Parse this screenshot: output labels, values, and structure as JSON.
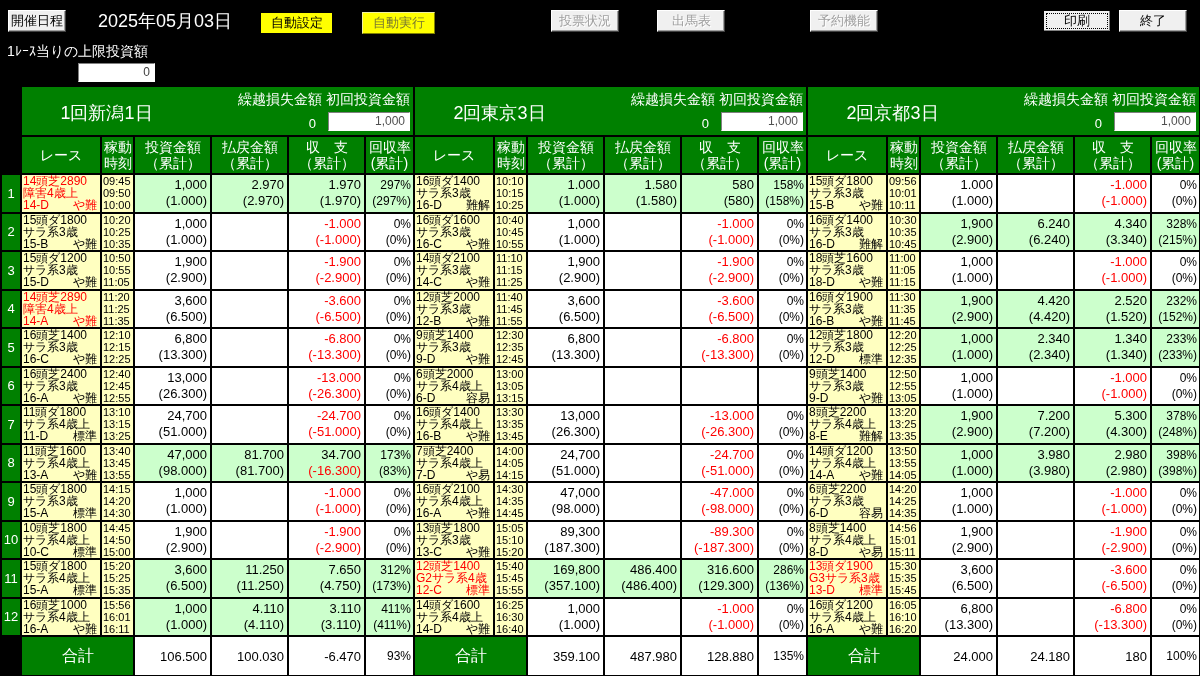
{
  "toolbar": {
    "buttons": [
      {
        "label": "開催日程",
        "kind": "plain",
        "disabled": false,
        "focused": false
      },
      {
        "label": "自動設定",
        "kind": "highlight",
        "on": true,
        "disabled": false,
        "focused": false
      },
      {
        "label": "自動実行",
        "kind": "highlight",
        "on": false,
        "disabled": false,
        "focused": false
      },
      {
        "label": "投票状況",
        "kind": "plain",
        "disabled": true,
        "focused": false
      },
      {
        "label": "出馬表",
        "kind": "plain",
        "disabled": true,
        "focused": false
      },
      {
        "label": "予約機能",
        "kind": "plain",
        "disabled": true,
        "focused": false
      },
      {
        "label": "印刷",
        "kind": "plain",
        "disabled": false,
        "focused": true
      },
      {
        "label": "終了",
        "kind": "plain",
        "disabled": false,
        "focused": false
      }
    ],
    "date": "2025年05月03日"
  },
  "limit": {
    "label": "1ﾚｰｽ当りの上限投資額",
    "value": "0"
  },
  "row_numbers": [
    "1",
    "2",
    "3",
    "4",
    "5",
    "6",
    "7",
    "8",
    "9",
    "10",
    "11",
    "12"
  ],
  "venues": [
    {
      "name": "1回新潟1日",
      "carryover_label": "繰越損失金額",
      "carryover": "0",
      "initial_label": "初回投資金額",
      "initial_amount": "1,000",
      "columns": [
        {
          "lines": [
            "レース"
          ]
        },
        {
          "lines": [
            "稼動",
            "時刻"
          ]
        },
        {
          "lines": [
            "投資金額",
            "（累計）"
          ]
        },
        {
          "lines": [
            "払戻金額",
            "（累計）"
          ]
        },
        {
          "lines": [
            "収　支",
            "（累計）"
          ]
        },
        {
          "lines": [
            "回収率",
            "(累計)"
          ]
        }
      ],
      "races": [
        {
          "featured": true,
          "hit": true,
          "race": [
            "14頭芝2890",
            "障害4歳上"
          ],
          "gate": "14-D",
          "rating": "や難",
          "times": [
            "09:45",
            "09:50",
            "10:00"
          ],
          "investment": [
            "1,000",
            "(1.000)"
          ],
          "payout": [
            "2.970",
            "(2.970)"
          ],
          "balance": [
            {
              "text": "1.970",
              "negative": false
            },
            {
              "text": "(1.970)",
              "negative": false
            }
          ],
          "rate": [
            "297%",
            "(297%)"
          ]
        },
        {
          "featured": false,
          "hit": false,
          "race": [
            "15頭ダ1800",
            "サラ系3歳"
          ],
          "gate": "15-B",
          "rating": "や難",
          "times": [
            "10:20",
            "10:25",
            "10:35"
          ],
          "investment": [
            "1,000",
            "(1.000)"
          ],
          "balance": [
            {
              "text": "-1.000",
              "negative": true
            },
            {
              "text": "(-1.000)",
              "negative": true
            }
          ],
          "rate": [
            "0%",
            "(0%)"
          ]
        },
        {
          "featured": false,
          "hit": false,
          "race": [
            "15頭ダ1200",
            "サラ系3歳"
          ],
          "gate": "15-D",
          "rating": "や難",
          "times": [
            "10:50",
            "10:55",
            "11:05"
          ],
          "investment": [
            "1,900",
            "(2.900)"
          ],
          "balance": [
            {
              "text": "-1.900",
              "negative": true
            },
            {
              "text": "(-2.900)",
              "negative": true
            }
          ],
          "rate": [
            "0%",
            "(0%)"
          ]
        },
        {
          "featured": true,
          "hit": false,
          "race": [
            "14頭芝2890",
            "障害4歳上"
          ],
          "gate": "14-A",
          "rating": "や難",
          "times": [
            "11:20",
            "11:25",
            "11:35"
          ],
          "investment": [
            "3,600",
            "(6.500)"
          ],
          "balance": [
            {
              "text": "-3.600",
              "negative": true
            },
            {
              "text": "(-6.500)",
              "negative": true
            }
          ],
          "rate": [
            "0%",
            "(0%)"
          ]
        },
        {
          "featured": false,
          "hit": false,
          "race": [
            "16頭芝1400",
            "サラ系3歳"
          ],
          "gate": "16-C",
          "rating": "や難",
          "times": [
            "12:10",
            "12:15",
            "12:25"
          ],
          "investment": [
            "6,800",
            "(13.300)"
          ],
          "balance": [
            {
              "text": "-6.800",
              "negative": true
            },
            {
              "text": "(-13.300)",
              "negative": true
            }
          ],
          "rate": [
            "0%",
            "(0%)"
          ]
        },
        {
          "featured": false,
          "hit": false,
          "race": [
            "16頭芝2400",
            "サラ系3歳"
          ],
          "gate": "16-A",
          "rating": "や難",
          "times": [
            "12:40",
            "12:45",
            "12:55"
          ],
          "investment": [
            "13,000",
            "(26.300)"
          ],
          "balance": [
            {
              "text": "-13.000",
              "negative": true
            },
            {
              "text": "(-26.300)",
              "negative": true
            }
          ],
          "rate": [
            "0%",
            "(0%)"
          ]
        },
        {
          "featured": false,
          "hit": false,
          "race": [
            "11頭ダ1800",
            "サラ系4歳上"
          ],
          "gate": "11-D",
          "rating": "標準",
          "times": [
            "13:10",
            "13:15",
            "13:25"
          ],
          "investment": [
            "24,700",
            "(51.000)"
          ],
          "balance": [
            {
              "text": "-24.700",
              "negative": true
            },
            {
              "text": "(-51.000)",
              "negative": true
            }
          ],
          "rate": [
            "0%",
            "(0%)"
          ]
        },
        {
          "featured": false,
          "hit": true,
          "race": [
            "11頭芝1600",
            "サラ系4歳上"
          ],
          "gate": "13-A",
          "rating": "や難",
          "times": [
            "13:40",
            "13:45",
            "13:55"
          ],
          "investment": [
            "47,000",
            "(98.000)"
          ],
          "payout": [
            "81.700",
            "(81.700)"
          ],
          "balance": [
            {
              "text": "34.700",
              "negative": false
            },
            {
              "text": "(-16.300)",
              "negative": true
            }
          ],
          "rate": [
            "173%",
            "(83%)"
          ]
        },
        {
          "featured": false,
          "hit": false,
          "race": [
            "15頭ダ1800",
            "サラ系3歳"
          ],
          "gate": "15-A",
          "rating": "標準",
          "times": [
            "14:15",
            "14:20",
            "14:30"
          ],
          "investment": [
            "1,000",
            "(1.000)"
          ],
          "balance": [
            {
              "text": "-1.000",
              "negative": true
            },
            {
              "text": "(-1.000)",
              "negative": true
            }
          ],
          "rate": [
            "0%",
            "(0%)"
          ]
        },
        {
          "featured": false,
          "hit": false,
          "race": [
            "10頭芝1800",
            "サラ系4歳上"
          ],
          "gate": "10-C",
          "rating": "標準",
          "times": [
            "14:45",
            "14:50",
            "15:00"
          ],
          "investment": [
            "1,900",
            "(2.900)"
          ],
          "balance": [
            {
              "text": "-1.900",
              "negative": true
            },
            {
              "text": "(-2.900)",
              "negative": true
            }
          ],
          "rate": [
            "0%",
            "(0%)"
          ]
        },
        {
          "featured": false,
          "hit": true,
          "race": [
            "15頭ダ1800",
            "サラ系4歳上"
          ],
          "gate": "15-A",
          "rating": "標準",
          "times": [
            "15:20",
            "15:25",
            "15:35"
          ],
          "investment": [
            "3,600",
            "(6.500)"
          ],
          "payout": [
            "11.250",
            "(11.250)"
          ],
          "balance": [
            {
              "text": "7.650",
              "negative": false
            },
            {
              "text": "(4.750)",
              "negative": false
            }
          ],
          "rate": [
            "312%",
            "(173%)"
          ]
        },
        {
          "featured": false,
          "hit": true,
          "race": [
            "16頭芝1000",
            "サラ系4歳上"
          ],
          "gate": "16-A",
          "rating": "や難",
          "times": [
            "15:56",
            "16:01",
            "16:11"
          ],
          "investment": [
            "1,000",
            "(1.000)"
          ],
          "payout": [
            "4.110",
            "(4.110)"
          ],
          "balance": [
            {
              "text": "3.110",
              "negative": false
            },
            {
              "text": "(3.110)",
              "negative": false
            }
          ],
          "rate": [
            "411%",
            "(411%)"
          ]
        }
      ],
      "total": {
        "label": "合計",
        "investment": "106.500",
        "payout": "100.030",
        "balance": "-6.470",
        "rate": "93%"
      }
    },
    {
      "name": "2回東京3日",
      "carryover_label": "繰越損失金額",
      "carryover": "0",
      "initial_label": "初回投資金額",
      "initial_amount": "1,000",
      "columns": [
        {
          "lines": [
            "レース"
          ]
        },
        {
          "lines": [
            "稼動",
            "時刻"
          ]
        },
        {
          "lines": [
            "投資金額",
            "（累計）"
          ]
        },
        {
          "lines": [
            "払戻金額",
            "（累計）"
          ]
        },
        {
          "lines": [
            "収　支",
            "（累計）"
          ]
        },
        {
          "lines": [
            "回収率",
            "(累計)"
          ]
        }
      ],
      "races": [
        {
          "featured": false,
          "hit": true,
          "race": [
            "16頭ダ1400",
            "サラ系3歳"
          ],
          "gate": "16-D",
          "rating": "難解",
          "times": [
            "10:10",
            "10:15",
            "10:25"
          ],
          "investment": [
            "1.000",
            "(1.000)"
          ],
          "payout": [
            "1.580",
            "(1.580)"
          ],
          "balance": [
            {
              "text": "580",
              "negative": false
            },
            {
              "text": "(580)",
              "negative": false
            }
          ],
          "rate": [
            "158%",
            "(158%)"
          ]
        },
        {
          "featured": false,
          "hit": false,
          "race": [
            "16頭ダ1600",
            "サラ系3歳"
          ],
          "gate": "16-C",
          "rating": "や難",
          "times": [
            "10:40",
            "10:45",
            "10:55"
          ],
          "investment": [
            "1,000",
            "(1.000)"
          ],
          "balance": [
            {
              "text": "-1.000",
              "negative": true
            },
            {
              "text": "(-1.000)",
              "negative": true
            }
          ],
          "rate": [
            "0%",
            "(0%)"
          ]
        },
        {
          "featured": false,
          "hit": false,
          "race": [
            "14頭ダ2100",
            "サラ系3歳"
          ],
          "gate": "14-C",
          "rating": "や難",
          "times": [
            "11:10",
            "11:15",
            "11:25"
          ],
          "investment": [
            "1,900",
            "(2.900)"
          ],
          "balance": [
            {
              "text": "-1.900",
              "negative": true
            },
            {
              "text": "(-2.900)",
              "negative": true
            }
          ],
          "rate": [
            "0%",
            "(0%)"
          ]
        },
        {
          "featured": false,
          "hit": false,
          "race": [
            "12頭芝2000",
            "サラ系3歳"
          ],
          "gate": "12-B",
          "rating": "や難",
          "times": [
            "11:40",
            "11:45",
            "11:55"
          ],
          "investment": [
            "3,600",
            "(6.500)"
          ],
          "balance": [
            {
              "text": "-3.600",
              "negative": true
            },
            {
              "text": "(-6.500)",
              "negative": true
            }
          ],
          "rate": [
            "0%",
            "(0%)"
          ]
        },
        {
          "featured": false,
          "hit": false,
          "race": [
            "9頭芝1400",
            "サラ系3歳"
          ],
          "gate": "9-D",
          "rating": "や難",
          "times": [
            "12:30",
            "12:35",
            "12:45"
          ],
          "investment": [
            "6,800",
            "(13.300)"
          ],
          "balance": [
            {
              "text": "-6.800",
              "negative": true
            },
            {
              "text": "(-13.300)",
              "negative": true
            }
          ],
          "rate": [
            "0%",
            "(0%)"
          ]
        },
        {
          "featured": false,
          "hit": false,
          "race": [
            "6頭芝2000",
            "サラ系4歳上"
          ],
          "gate": "6-D",
          "rating": "容易",
          "times": [
            "13:00",
            "13:05",
            "13:15"
          ]
        },
        {
          "featured": false,
          "hit": false,
          "race": [
            "16頭ダ1400",
            "サラ系4歳上"
          ],
          "gate": "16-B",
          "rating": "や難",
          "times": [
            "13:30",
            "13:35",
            "13:45"
          ],
          "investment": [
            "13,000",
            "(26.300)"
          ],
          "balance": [
            {
              "text": "-13.000",
              "negative": true
            },
            {
              "text": "(-26.300)",
              "negative": true
            }
          ],
          "rate": [
            "0%",
            "(0%)"
          ]
        },
        {
          "featured": false,
          "hit": false,
          "race": [
            "7頭芝2400",
            "サラ系4歳上"
          ],
          "gate": "7-D",
          "rating": "や易",
          "times": [
            "14:00",
            "14:05",
            "14:15"
          ],
          "investment": [
            "24,700",
            "(51.000)"
          ],
          "balance": [
            {
              "text": "-24.700",
              "negative": true
            },
            {
              "text": "(-51.000)",
              "negative": true
            }
          ],
          "rate": [
            "0%",
            "(0%)"
          ]
        },
        {
          "featured": false,
          "hit": false,
          "race": [
            "16頭ダ2100",
            "サラ系4歳上"
          ],
          "gate": "16-A",
          "rating": "や難",
          "times": [
            "14:30",
            "14:35",
            "14:45"
          ],
          "investment": [
            "47,000",
            "(98.000)"
          ],
          "balance": [
            {
              "text": "-47.000",
              "negative": true
            },
            {
              "text": "(-98.000)",
              "negative": true
            }
          ],
          "rate": [
            "0%",
            "(0%)"
          ]
        },
        {
          "featured": false,
          "hit": false,
          "race": [
            "13頭芝1800",
            "サラ系3歳"
          ],
          "gate": "13-C",
          "rating": "や難",
          "times": [
            "15:05",
            "15:10",
            "15:20"
          ],
          "investment": [
            "89,300",
            "(187.300)"
          ],
          "balance": [
            {
              "text": "-89.300",
              "negative": true
            },
            {
              "text": "(-187.300)",
              "negative": true
            }
          ],
          "rate": [
            "0%",
            "(0%)"
          ]
        },
        {
          "featured": true,
          "hit": true,
          "race": [
            "12頭芝1400",
            "G2サラ系4歳"
          ],
          "gate": "12-C",
          "rating": "標準",
          "times": [
            "15:40",
            "15:45",
            "15:55"
          ],
          "investment": [
            "169,800",
            "(357.100)"
          ],
          "payout": [
            "486.400",
            "(486.400)"
          ],
          "balance": [
            {
              "text": "316.600",
              "negative": false
            },
            {
              "text": "(129.300)",
              "negative": false
            }
          ],
          "rate": [
            "286%",
            "(136%)"
          ]
        },
        {
          "featured": false,
          "hit": false,
          "race": [
            "14頭ダ1600",
            "サラ系4歳上"
          ],
          "gate": "14-D",
          "rating": "や難",
          "times": [
            "16:25",
            "16:30",
            "16:40"
          ],
          "investment": [
            "1,000",
            "(1.000)"
          ],
          "balance": [
            {
              "text": "-1.000",
              "negative": true
            },
            {
              "text": "(-1.000)",
              "negative": true
            }
          ],
          "rate": [
            "0%",
            "(0%)"
          ]
        }
      ],
      "total": {
        "label": "合計",
        "investment": "359.100",
        "payout": "487.980",
        "balance": "128.880",
        "rate": "135%"
      }
    },
    {
      "name": "2回京都3日",
      "carryover_label": "繰越損失金額",
      "carryover": "0",
      "initial_label": "初回投資金額",
      "initial_amount": "1,000",
      "columns": [
        {
          "lines": [
            "レース"
          ]
        },
        {
          "lines": [
            "稼動",
            "時刻"
          ]
        },
        {
          "lines": [
            "投資金額",
            "（累計）"
          ]
        },
        {
          "lines": [
            "払戻金額",
            "（累計）"
          ]
        },
        {
          "lines": [
            "収　支",
            "（累計）"
          ]
        },
        {
          "lines": [
            "回収率",
            "(累計)"
          ]
        }
      ],
      "races": [
        {
          "featured": false,
          "hit": false,
          "race": [
            "15頭ダ1800",
            "サラ系3歳"
          ],
          "gate": "15-B",
          "rating": "や難",
          "times": [
            "09:56",
            "10:01",
            "10:11"
          ],
          "investment": [
            "1.000",
            "(1.000)"
          ],
          "balance": [
            {
              "text": "-1.000",
              "negative": true
            },
            {
              "text": "(-1.000)",
              "negative": true
            }
          ],
          "rate": [
            "0%",
            "(0%)"
          ]
        },
        {
          "featured": false,
          "hit": true,
          "race": [
            "16頭ダ1400",
            "サラ系3歳"
          ],
          "gate": "16-D",
          "rating": "難解",
          "times": [
            "10:30",
            "10:35",
            "10:45"
          ],
          "investment": [
            "1,900",
            "(2.900)"
          ],
          "payout": [
            "6.240",
            "(6.240)"
          ],
          "balance": [
            {
              "text": "4.340",
              "negative": false
            },
            {
              "text": "(3.340)",
              "negative": false
            }
          ],
          "rate": [
            "328%",
            "(215%)"
          ]
        },
        {
          "featured": false,
          "hit": false,
          "race": [
            "18頭芝1600",
            "サラ系3歳"
          ],
          "gate": "18-D",
          "rating": "や難",
          "times": [
            "11:00",
            "11:05",
            "11:15"
          ],
          "investment": [
            "1,000",
            "(1.000)"
          ],
          "balance": [
            {
              "text": "-1.000",
              "negative": true
            },
            {
              "text": "(-1.000)",
              "negative": true
            }
          ],
          "rate": [
            "0%",
            "(0%)"
          ]
        },
        {
          "featured": false,
          "hit": true,
          "race": [
            "16頭ダ1900",
            "サラ系3歳"
          ],
          "gate": "16-B",
          "rating": "や難",
          "times": [
            "11:30",
            "11:35",
            "11:45"
          ],
          "investment": [
            "1,900",
            "(2.900)"
          ],
          "payout": [
            "4.420",
            "(4.420)"
          ],
          "balance": [
            {
              "text": "2.520",
              "negative": false
            },
            {
              "text": "(1.520)",
              "negative": false
            }
          ],
          "rate": [
            "232%",
            "(152%)"
          ]
        },
        {
          "featured": false,
          "hit": true,
          "race": [
            "12頭芝1800",
            "サラ系3歳"
          ],
          "gate": "12-D",
          "rating": "標準",
          "times": [
            "12:20",
            "12:25",
            "12:35"
          ],
          "investment": [
            "1,000",
            "(1.000)"
          ],
          "payout": [
            "2.340",
            "(2.340)"
          ],
          "balance": [
            {
              "text": "1.340",
              "negative": false
            },
            {
              "text": "(1.340)",
              "negative": false
            }
          ],
          "rate": [
            "233%",
            "(233%)"
          ]
        },
        {
          "featured": false,
          "hit": false,
          "race": [
            "9頭芝1400",
            "サラ系3歳"
          ],
          "gate": "9-D",
          "rating": "や難",
          "times": [
            "12:50",
            "12:55",
            "13:05"
          ],
          "investment": [
            "1,000",
            "(1.000)"
          ],
          "balance": [
            {
              "text": "-1.000",
              "negative": true
            },
            {
              "text": "(-1.000)",
              "negative": true
            }
          ],
          "rate": [
            "0%",
            "(0%)"
          ]
        },
        {
          "featured": false,
          "hit": true,
          "race": [
            "8頭芝2200",
            "サラ系4歳上"
          ],
          "gate": "8-E",
          "rating": "難解",
          "times": [
            "13:20",
            "13:25",
            "13:35"
          ],
          "investment": [
            "1,900",
            "(2.900)"
          ],
          "payout": [
            "7.200",
            "(7.200)"
          ],
          "balance": [
            {
              "text": "5.300",
              "negative": false
            },
            {
              "text": "(4.300)",
              "negative": false
            }
          ],
          "rate": [
            "378%",
            "(248%)"
          ]
        },
        {
          "featured": false,
          "hit": true,
          "race": [
            "14頭ダ1200",
            "サラ系4歳上"
          ],
          "gate": "14-A",
          "rating": "や難",
          "times": [
            "13:50",
            "13:55",
            "14:05"
          ],
          "investment": [
            "1,000",
            "(1.000)"
          ],
          "payout": [
            "3.980",
            "(3.980)"
          ],
          "balance": [
            {
              "text": "2.980",
              "negative": false
            },
            {
              "text": "(2.980)",
              "negative": false
            }
          ],
          "rate": [
            "398%",
            "(398%)"
          ]
        },
        {
          "featured": false,
          "hit": false,
          "race": [
            "6頭芝2200",
            "サラ系3歳"
          ],
          "gate": "6-D",
          "rating": "容易",
          "times": [
            "14:20",
            "14:25",
            "14:35"
          ],
          "investment": [
            "1,000",
            "(1.000)"
          ],
          "balance": [
            {
              "text": "-1.000",
              "negative": true
            },
            {
              "text": "(-1.000)",
              "negative": true
            }
          ],
          "rate": [
            "0%",
            "(0%)"
          ]
        },
        {
          "featured": false,
          "hit": false,
          "race": [
            "8頭芝1400",
            "サラ系4歳上"
          ],
          "gate": "8-D",
          "rating": "や易",
          "times": [
            "14:56",
            "15:01",
            "15:11"
          ],
          "investment": [
            "1,900",
            "(2.900)"
          ],
          "balance": [
            {
              "text": "-1.900",
              "negative": true
            },
            {
              "text": "(-2.900)",
              "negative": true
            }
          ],
          "rate": [
            "0%",
            "(0%)"
          ]
        },
        {
          "featured": true,
          "hit": false,
          "race": [
            "13頭ダ1900",
            "G3サラ系3歳"
          ],
          "gate": "13-D",
          "rating": "標準",
          "times": [
            "15:30",
            "15:35",
            "15:45"
          ],
          "investment": [
            "3,600",
            "(6.500)"
          ],
          "balance": [
            {
              "text": "-3.600",
              "negative": true
            },
            {
              "text": "(-6.500)",
              "negative": true
            }
          ],
          "rate": [
            "0%",
            "(0%)"
          ]
        },
        {
          "featured": false,
          "hit": false,
          "race": [
            "16頭ダ1200",
            "サラ系4歳上"
          ],
          "gate": "16-A",
          "rating": "や難",
          "times": [
            "16:05",
            "16:10",
            "16:20"
          ],
          "investment": [
            "6,800",
            "(13.300)"
          ],
          "balance": [
            {
              "text": "-6.800",
              "negative": true
            },
            {
              "text": "(-13.300)",
              "negative": true
            }
          ],
          "rate": [
            "0%",
            "(0%)"
          ]
        }
      ],
      "total": {
        "label": "合計",
        "investment": "24.000",
        "payout": "24.180",
        "balance": "180",
        "rate": "100%"
      }
    }
  ]
}
